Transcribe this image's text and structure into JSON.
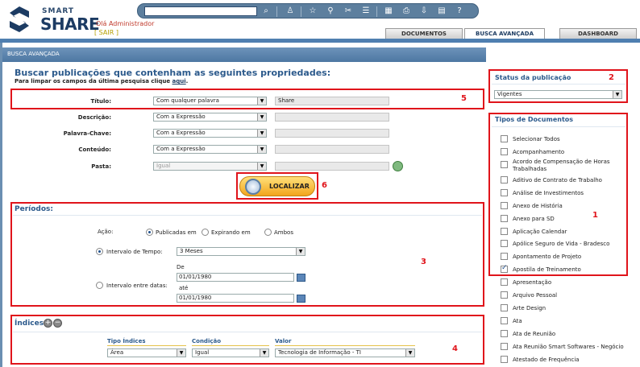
{
  "brand": {
    "smart": "SMART",
    "share": "SHARE"
  },
  "user": {
    "greeting": "Olá Administrador",
    "logout": "[ SAIR ]"
  },
  "tabs": [
    {
      "label": "DOCUMENTOS",
      "active": false
    },
    {
      "label": "BUSCA AVANÇADA",
      "active": true
    },
    {
      "label": "DASHBOARD",
      "active": false
    }
  ],
  "section_header": "BUSCA AVANÇADA",
  "heading": "Buscar publicações que contenham as seguintes propriedades:",
  "subheading": {
    "prefix": "Para limpar os campos da última pesquisa clique ",
    "link": "aqui",
    "suffix": "."
  },
  "form": {
    "rows": [
      {
        "label": "Título:",
        "condition": "Com qualquer palavra",
        "value": "Share",
        "disabled": false
      },
      {
        "label": "Descrição:",
        "condition": "Com a Expressão",
        "value": "",
        "disabled": false
      },
      {
        "label": "Palavra-Chave:",
        "condition": "Com a Expressão",
        "value": "",
        "disabled": false
      },
      {
        "label": "Conteúdo:",
        "condition": "Com a Expressão",
        "value": "",
        "disabled": false
      },
      {
        "label": "Pasta:",
        "condition": "Igual",
        "value": "",
        "disabled": true
      }
    ],
    "search_button": "LOCALIZAR"
  },
  "periodos": {
    "title": "Períodos:",
    "acao_label": "Ação:",
    "acao_options": [
      "Publicadas em",
      "Expirando em",
      "Ambos"
    ],
    "acao_selected": "Publicadas em",
    "intervalo_tempo_label": "Intervalo de Tempo:",
    "intervalo_tempo_value": "3 Meses",
    "intervalo_datas_label": "Intervalo entre datas:",
    "de_label": "De",
    "de_value": "01/01/1980",
    "ate_label": "até",
    "ate_value": "01/01/1980"
  },
  "indices": {
    "title": "Índices:",
    "headers": [
      "Tipo Índices",
      "Condição",
      "Valor"
    ],
    "row": {
      "tipo": "Área",
      "condicao": "Igual",
      "valor": "Tecnologia de Informação - TI"
    }
  },
  "status": {
    "title": "Status da publicação",
    "value": "Vigentes"
  },
  "tipos": {
    "title": "Tipos de Documentos",
    "items": [
      {
        "label": "Selecionar Todos",
        "checked": false
      },
      {
        "label": "Acompanhamento",
        "checked": false
      },
      {
        "label": "Acordo de Compensação de Horas Trabalhadas",
        "checked": false
      },
      {
        "label": "Aditivo de Contrato de Trabalho",
        "checked": false
      },
      {
        "label": "Análise de Investimentos",
        "checked": false
      },
      {
        "label": "Anexo de História",
        "checked": false
      },
      {
        "label": "Anexo para SD",
        "checked": false
      },
      {
        "label": "Aplicação Calendar",
        "checked": false
      },
      {
        "label": "Apólice Seguro de Vida - Bradesco",
        "checked": false
      },
      {
        "label": "Apontamento de Projeto",
        "checked": false
      },
      {
        "label": "Apostila de Treinamento",
        "checked": true
      },
      {
        "label": "Apresentação",
        "checked": false
      },
      {
        "label": "Arquivo Pessoal",
        "checked": false
      },
      {
        "label": "Arte Design",
        "checked": false
      },
      {
        "label": "Ata",
        "checked": false
      },
      {
        "label": "Ata de Reunião",
        "checked": false
      },
      {
        "label": "Ata Reunião Smart Softwares - Negócio",
        "checked": false
      },
      {
        "label": "Atestado de Frequência",
        "checked": false
      }
    ]
  },
  "annotations": [
    "1",
    "2",
    "3",
    "4",
    "5",
    "6"
  ],
  "colors": {
    "accent": "#2c5a8c",
    "highlight": "#e0141b",
    "button": "#f2a51c"
  }
}
